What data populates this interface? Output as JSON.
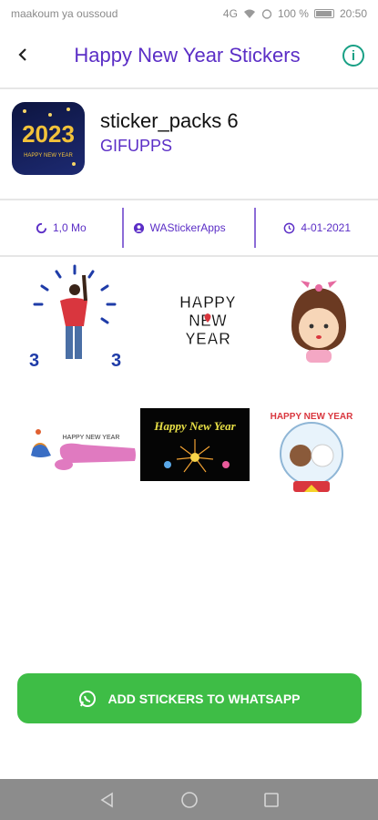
{
  "status": {
    "carrier": "maakoum ya oussoud",
    "signal": "4G",
    "battery": "100 %",
    "time": "20:50"
  },
  "app_bar": {
    "title": "Happy New Year Stickers"
  },
  "pack": {
    "icon": {
      "year": "2023",
      "subtitle": "HAPPY NEW YEAR"
    },
    "name": "sticker_packs 6",
    "author": "GIFUPPS"
  },
  "meta": {
    "size": "1,0 Mo",
    "publisher": "WAStickerApps",
    "date": "4-01-2021"
  },
  "stickers": [
    {
      "name": "sticker-clock-woman",
      "digits": "3 3"
    },
    {
      "name": "sticker-happy-new-year-text",
      "lines": [
        "HAPPY",
        "NEW",
        "YEAR"
      ]
    },
    {
      "name": "sticker-cartoon-girl"
    },
    {
      "name": "sticker-sleeping-cat",
      "text": "HAPPY NEW YEAR"
    },
    {
      "name": "sticker-fireworks",
      "text": "Happy New Year"
    },
    {
      "name": "sticker-globe-bears",
      "text": "HAPPY NEW YEAR"
    }
  ],
  "actions": {
    "add_label": "ADD STICKERS TO WHATSAPP"
  },
  "colors": {
    "accent": "#5b2ec6",
    "button": "#3ebd46",
    "info": "#19a085"
  },
  "icons": {
    "back": "arrow-back-icon",
    "info": "info-icon",
    "size": "storage-icon",
    "publisher": "account-icon",
    "date": "clock-icon",
    "whatsapp": "whatsapp-icon",
    "nav_back": "nav-back-icon",
    "nav_home": "nav-home-icon",
    "nav_recents": "nav-recents-icon"
  }
}
